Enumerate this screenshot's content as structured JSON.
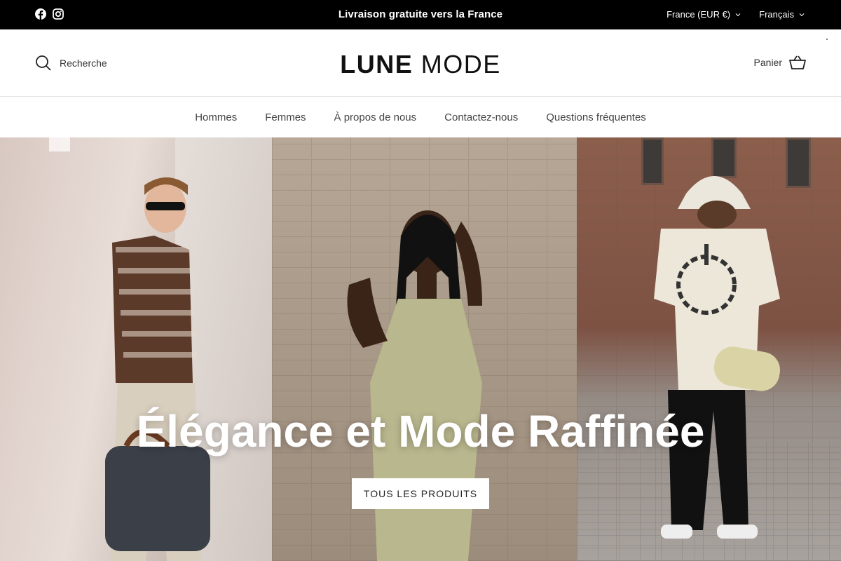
{
  "announcement": {
    "text": "Livraison gratuite vers la France",
    "social_icons": [
      "facebook-icon",
      "instagram-icon"
    ],
    "country_selector": "France (EUR €)",
    "language_selector": "Français"
  },
  "header": {
    "search_label": "Recherche",
    "logo_bold": "LUNE",
    "logo_light": "MODE",
    "cart_label": "Panier"
  },
  "nav": {
    "items": [
      "Hommes",
      "Femmes",
      "À propos de nous",
      "Contactez-nous",
      "Questions fréquentes"
    ]
  },
  "hero": {
    "title": "Élégance et Mode Raffinée",
    "button_label": "TOUS LES PRODUITS"
  },
  "colors": {
    "announcement_bg": "#000000",
    "hero_text": "#ffffff",
    "button_bg": "#ffffff"
  }
}
